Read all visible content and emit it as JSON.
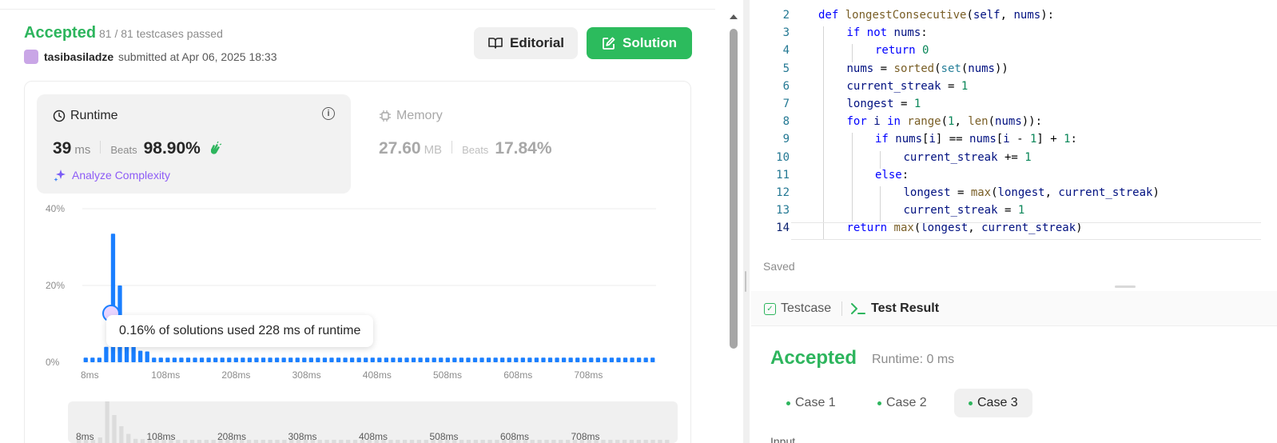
{
  "submission": {
    "status": "Accepted",
    "testcases": "81 / 81 testcases passed",
    "user": "tasibasiladze",
    "submitted_at": "submitted at Apr 06, 2025 18:33",
    "editorial_label": "Editorial",
    "solution_label": "Solution"
  },
  "runtime": {
    "title": "Runtime",
    "value": "39",
    "unit": "ms",
    "beats_label": "Beats",
    "beats_value": "98.90%",
    "analyze_label": "Analyze Complexity"
  },
  "memory": {
    "title": "Memory",
    "value": "27.60",
    "unit": "MB",
    "beats_label": "Beats",
    "beats_value": "17.84%"
  },
  "tooltip": "0.16% of solutions used 228 ms of runtime",
  "chart_data": {
    "type": "bar",
    "ylabel_ticks": [
      "40%",
      "20%",
      "0%"
    ],
    "ylim": [
      0,
      40
    ],
    "xticks": [
      "8ms",
      "108ms",
      "208ms",
      "308ms",
      "408ms",
      "508ms",
      "608ms",
      "708ms"
    ],
    "values": [
      1.2,
      1.2,
      1.2,
      4,
      33.5,
      20,
      12,
      6.5,
      3,
      2.8,
      1.2,
      1.2,
      1.2,
      1.2,
      1.2,
      1.2,
      1.2,
      1.2,
      1.2,
      1.2,
      1.2,
      1.2,
      1.2,
      1.2,
      1.2,
      1.2,
      1.2,
      1.2,
      1.2,
      1.2,
      1.2,
      1.2,
      1.2,
      1.2,
      1.2,
      1.2,
      1.2,
      1.2,
      1.2,
      1.2,
      1.2,
      1.2,
      1.2,
      1.2,
      1.2,
      1.2,
      1.2,
      1.2,
      1.2,
      1.2,
      1.2,
      1.2,
      1.2,
      1.2,
      1.2,
      1.2,
      1.2,
      1.2,
      1.2,
      1.2,
      1.2,
      1.2,
      1.2,
      1.2,
      1.2,
      1.2,
      1.2,
      1.2,
      1.2,
      1.2,
      1.2,
      1.2,
      1.2,
      1.2,
      1.2,
      1.2,
      1.2,
      1.2,
      1.2,
      1.2,
      1.2,
      1.2,
      1.2,
      1.2
    ],
    "bar_color": "#1a7fff",
    "grid": true
  },
  "mini_chart": {
    "xticks": [
      "8ms",
      "108ms",
      "208ms",
      "308ms",
      "408ms",
      "508ms",
      "608ms",
      "708ms"
    ]
  },
  "editor": {
    "lines": [
      {
        "n": "2",
        "indent": 0,
        "html": "<span class='kw'>def</span> <span class='fn'>longestConsecutive</span>(<span class='var'>self</span>, <span class='var'>nums</span>):"
      },
      {
        "n": "3",
        "indent": 1,
        "html": "<span class='kw'>if</span> <span class='kw'>not</span> <span class='var'>nums</span>:"
      },
      {
        "n": "4",
        "indent": 2,
        "html": "<span class='kw'>return</span> <span class='num'>0</span>"
      },
      {
        "n": "5",
        "indent": 1,
        "html": "<span class='var'>nums</span> = <span class='fn'>sorted</span>(<span class='bi'>set</span>(<span class='var'>nums</span>))"
      },
      {
        "n": "6",
        "indent": 1,
        "html": "<span class='var'>current_streak</span> = <span class='num'>1</span>"
      },
      {
        "n": "7",
        "indent": 1,
        "html": "<span class='var'>longest</span> = <span class='num'>1</span>"
      },
      {
        "n": "8",
        "indent": 1,
        "html": "<span class='kw'>for</span> <span class='var'>i</span> <span class='kw'>in</span> <span class='fn'>range</span>(<span class='num'>1</span>, <span class='fn'>len</span>(<span class='var'>nums</span>)):"
      },
      {
        "n": "9",
        "indent": 2,
        "html": "<span class='kw'>if</span> <span class='var'>nums</span>[<span class='var'>i</span>] == <span class='var'>nums</span>[<span class='var'>i</span> - <span class='num'>1</span>] + <span class='num'>1</span>:"
      },
      {
        "n": "10",
        "indent": 3,
        "html": "<span class='var'>current_streak</span> += <span class='num'>1</span>"
      },
      {
        "n": "11",
        "indent": 2,
        "html": "<span class='kw'>else</span>:"
      },
      {
        "n": "12",
        "indent": 3,
        "html": "<span class='var'>longest</span> = <span class='fn'>max</span>(<span class='var'>longest</span>, <span class='var'>current_streak</span>)"
      },
      {
        "n": "13",
        "indent": 3,
        "html": "<span class='var'>current_streak</span> = <span class='num'>1</span>"
      },
      {
        "n": "14",
        "indent": 1,
        "html": "<span class='kw'>return</span> <span class='fn'>max</span>(<span class='var'>longest</span>, <span class='var'>current_streak</span>)"
      }
    ],
    "current_line": "14",
    "saved_label": "Saved"
  },
  "testpanel": {
    "testcase_tab": "Testcase",
    "result_tab": "Test Result",
    "result_status": "Accepted",
    "result_runtime": "Runtime: 0 ms",
    "cases": [
      "Case 1",
      "Case 2",
      "Case 3"
    ],
    "selected_case": 2,
    "input_label": "Input"
  },
  "colors": {
    "accepted": "#2db55d",
    "solution_button": "#2cbb5d",
    "chart_bar": "#1a7fff",
    "analyze": "#8d5cf6"
  }
}
